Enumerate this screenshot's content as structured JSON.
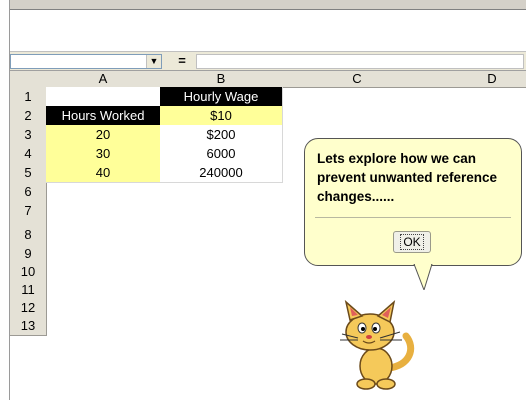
{
  "formula_bar": {
    "name_value": "",
    "equals": "=",
    "formula_value": ""
  },
  "columns": [
    "A",
    "B",
    "C",
    "D"
  ],
  "rows": [
    "1",
    "2",
    "3",
    "4",
    "5",
    "6",
    "7",
    "8",
    "9",
    "10",
    "11",
    "12",
    "13"
  ],
  "cells": {
    "B1": "Hourly Wage",
    "A2": "Hours Worked",
    "B2": "$10",
    "A3": "20",
    "B3": "$200",
    "A4": "30",
    "B4": "6000",
    "A5": "40",
    "B5": "240000"
  },
  "assistant": {
    "message": "Lets explore how we can prevent unwanted reference changes......",
    "ok_label": "OK"
  },
  "colors": {
    "highlight_yellow": "#ffff99",
    "header_black": "#000000",
    "balloon": "#ffffcc"
  }
}
